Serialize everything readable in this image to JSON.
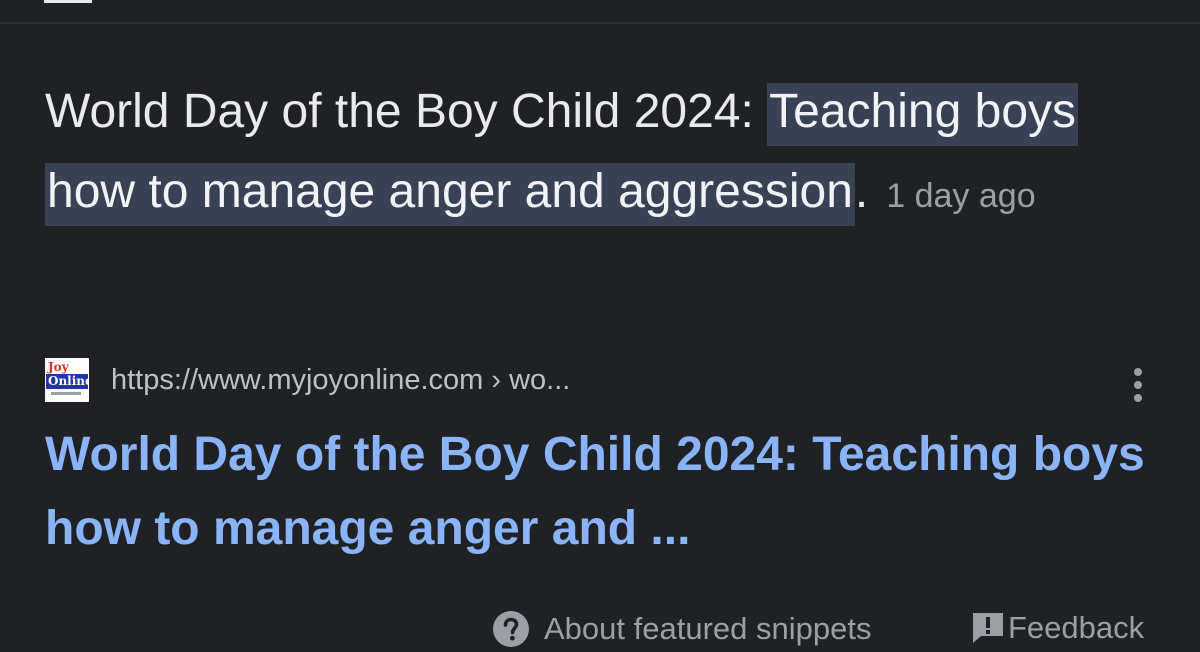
{
  "featured_snippet": {
    "text_plain": "World Day of the Boy Child 2024: ",
    "text_highlighted": "Teaching boys how to manage anger and aggression",
    "text_end": ".",
    "date": "1 day ago"
  },
  "source": {
    "favicon_joy": "Joy",
    "favicon_online": "Online",
    "url": "https://www.myjoyonline.com",
    "breadcrumb": " › wo..."
  },
  "result": {
    "title": "World Day of the Boy Child 2024: Teaching boys how to manage anger and ..."
  },
  "footer": {
    "about_label": "About featured snippets",
    "feedback_label": "Feedback"
  },
  "colors": {
    "background": "#202124",
    "highlight": "#394157",
    "link": "#8ab4f8",
    "muted": "#9aa0a6"
  },
  "icons": {
    "more": "more-vert-icon",
    "help": "help-circle-icon",
    "feedback": "feedback-icon"
  }
}
